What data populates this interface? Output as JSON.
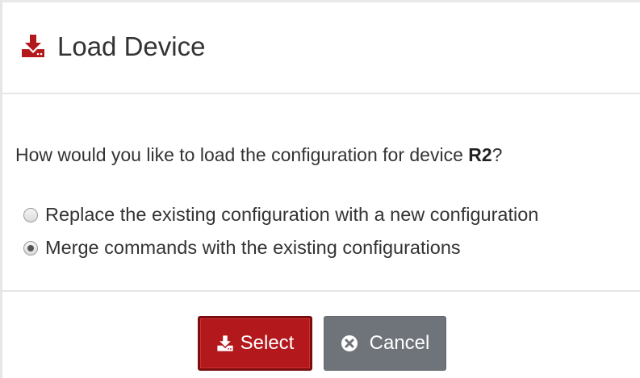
{
  "dialog": {
    "title": "Load Device",
    "title_icon": "download-icon",
    "accent_color": "#b3181c"
  },
  "body": {
    "question_prefix": "How would you like to load the configuration for device ",
    "device_name": "R2",
    "question_suffix": "?",
    "options": [
      {
        "label": "Replace the existing configuration with a new configuration",
        "checked": false
      },
      {
        "label": "Merge commands with the existing configurations",
        "checked": true
      }
    ]
  },
  "footer": {
    "select_label": "Select",
    "select_icon": "download-icon",
    "select_color": "#b3181c",
    "cancel_label": "Cancel",
    "cancel_icon": "times-circle-icon",
    "cancel_color": "#6f747a"
  }
}
